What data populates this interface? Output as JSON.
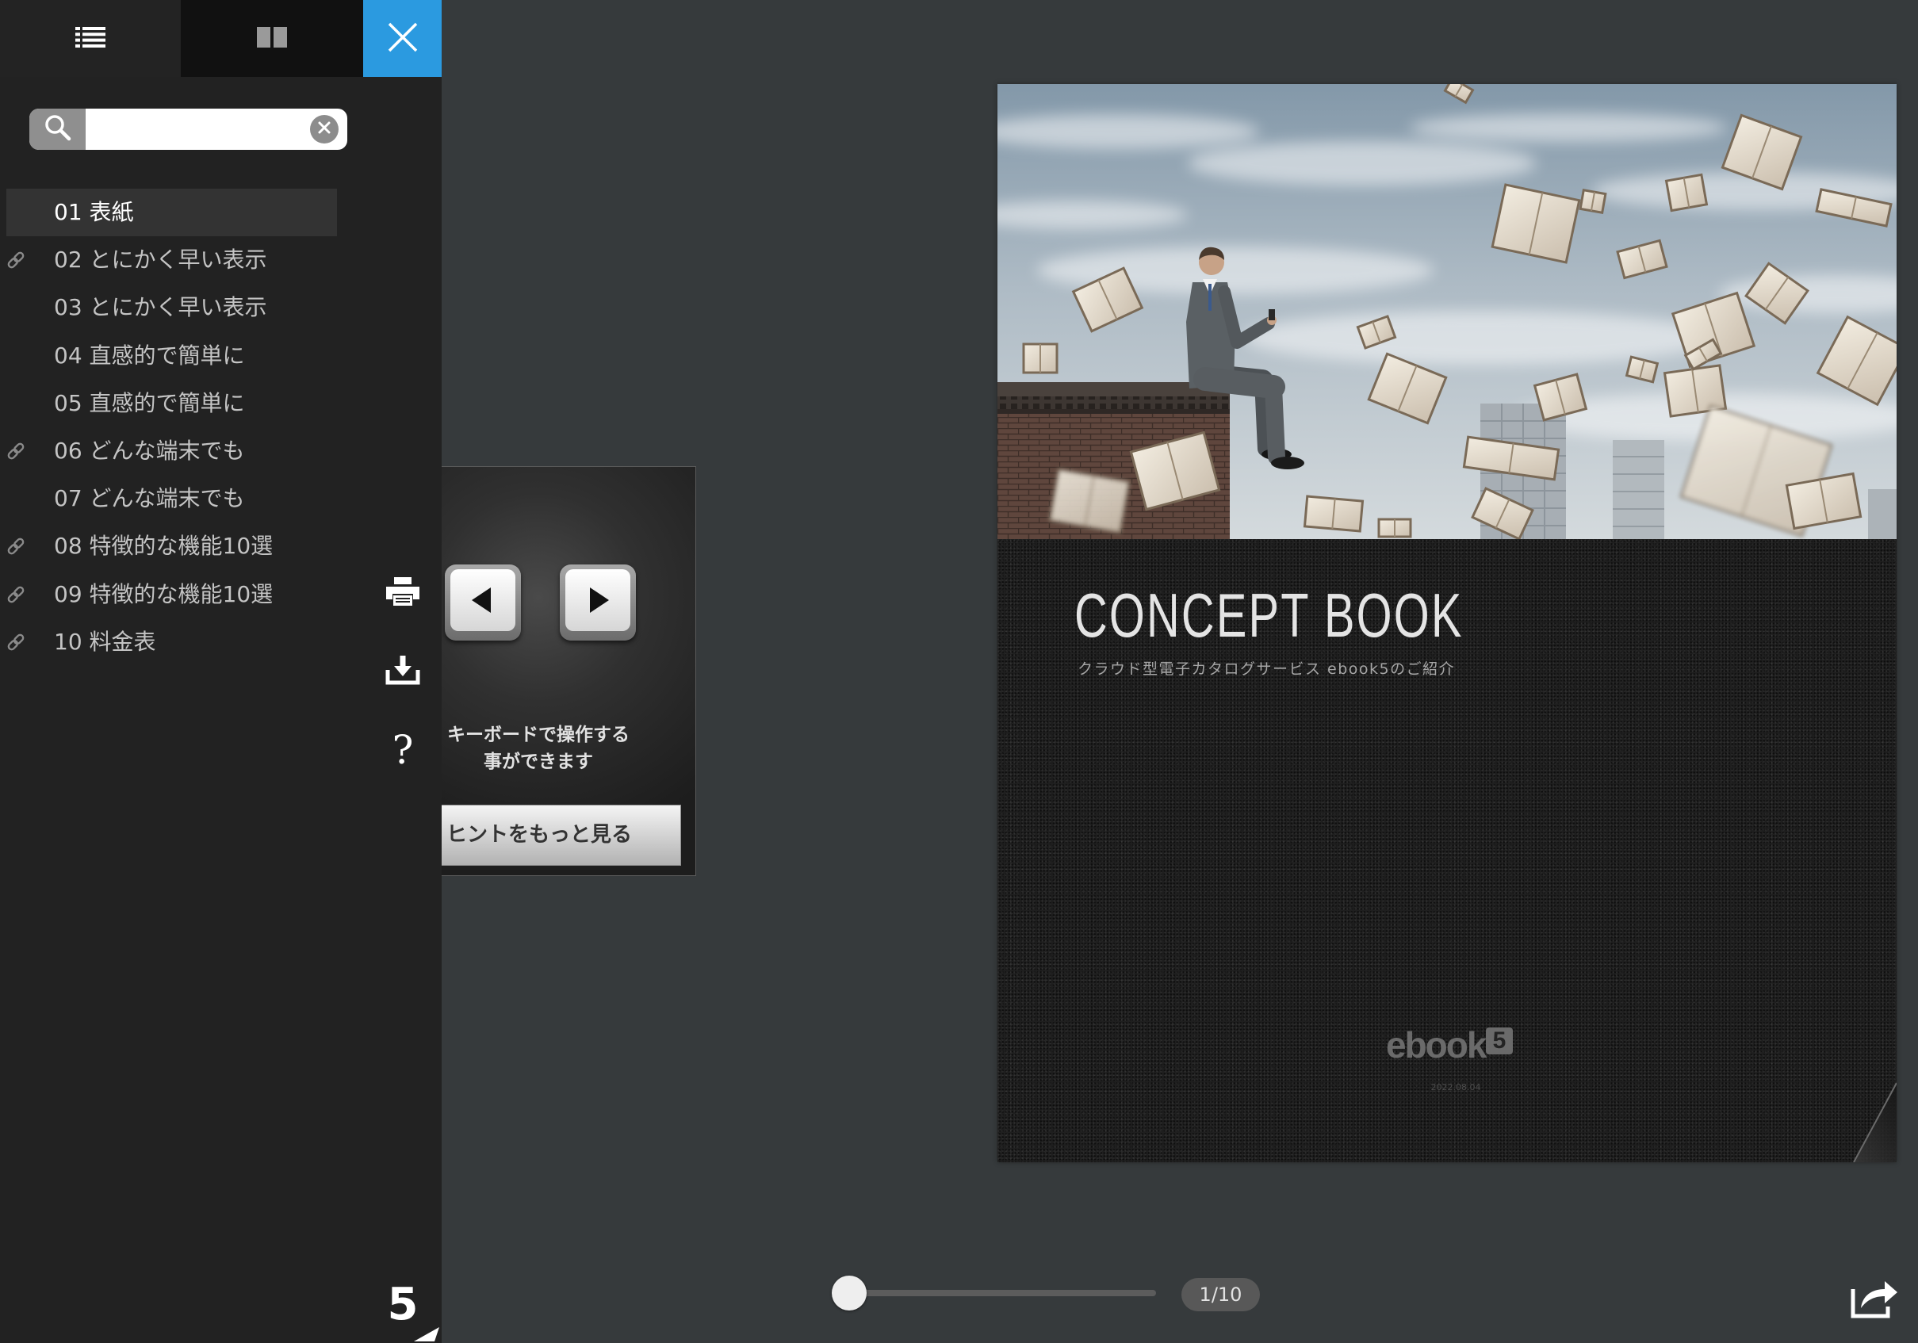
{
  "sidebar": {
    "tabs": [
      {
        "icon": "list-icon",
        "active": true
      },
      {
        "icon": "two-page-icon",
        "active": false
      }
    ],
    "close_icon": "close-icon",
    "search": {
      "value": "",
      "placeholder": "",
      "icon": "search-icon",
      "clear_icon": "clear-icon"
    },
    "toc_items": [
      {
        "label": "01 表紙",
        "has_link": false,
        "active": true
      },
      {
        "label": "02 とにかく早い表示",
        "has_link": true,
        "active": false
      },
      {
        "label": "03 とにかく早い表示",
        "has_link": false,
        "active": false
      },
      {
        "label": "04 直感的で簡単に",
        "has_link": false,
        "active": false
      },
      {
        "label": "05 直感的で簡単に",
        "has_link": false,
        "active": false
      },
      {
        "label": "06 どんな端末でも",
        "has_link": true,
        "active": false
      },
      {
        "label": "07 どんな端末でも",
        "has_link": false,
        "active": false
      },
      {
        "label": "08 特徴的な機能10選",
        "has_link": true,
        "active": false
      },
      {
        "label": "09 特徴的な機能10選",
        "has_link": true,
        "active": false
      },
      {
        "label": "10 料金表",
        "has_link": true,
        "active": false
      }
    ],
    "tools": [
      {
        "icon": "print-icon"
      },
      {
        "icon": "download-icon"
      },
      {
        "icon": "help-icon",
        "label": "?"
      }
    ],
    "brand_mark": "5"
  },
  "hint": {
    "keys": [
      "left-arrow-key-icon",
      "right-arrow-key-icon"
    ],
    "message_line1": "キーボードで操作する",
    "message_line2": "事ができます",
    "more_button": "ヒントをもっと見る"
  },
  "page": {
    "title": "CONCEPT BOOK",
    "subtitle": "クラウド型電子カタログサービス ebook5のご紹介",
    "logo_text": "ebook",
    "logo_number": "5",
    "date": "2022.08.04"
  },
  "navigation": {
    "current_page": 1,
    "total_pages": 10,
    "page_indicator": "1/10",
    "share_icon": "share-icon"
  },
  "colors": {
    "accent": "#2b9ae0",
    "sidebar_bg": "#222222",
    "viewer_bg": "#363a3c",
    "active_item_bg": "#333333"
  }
}
